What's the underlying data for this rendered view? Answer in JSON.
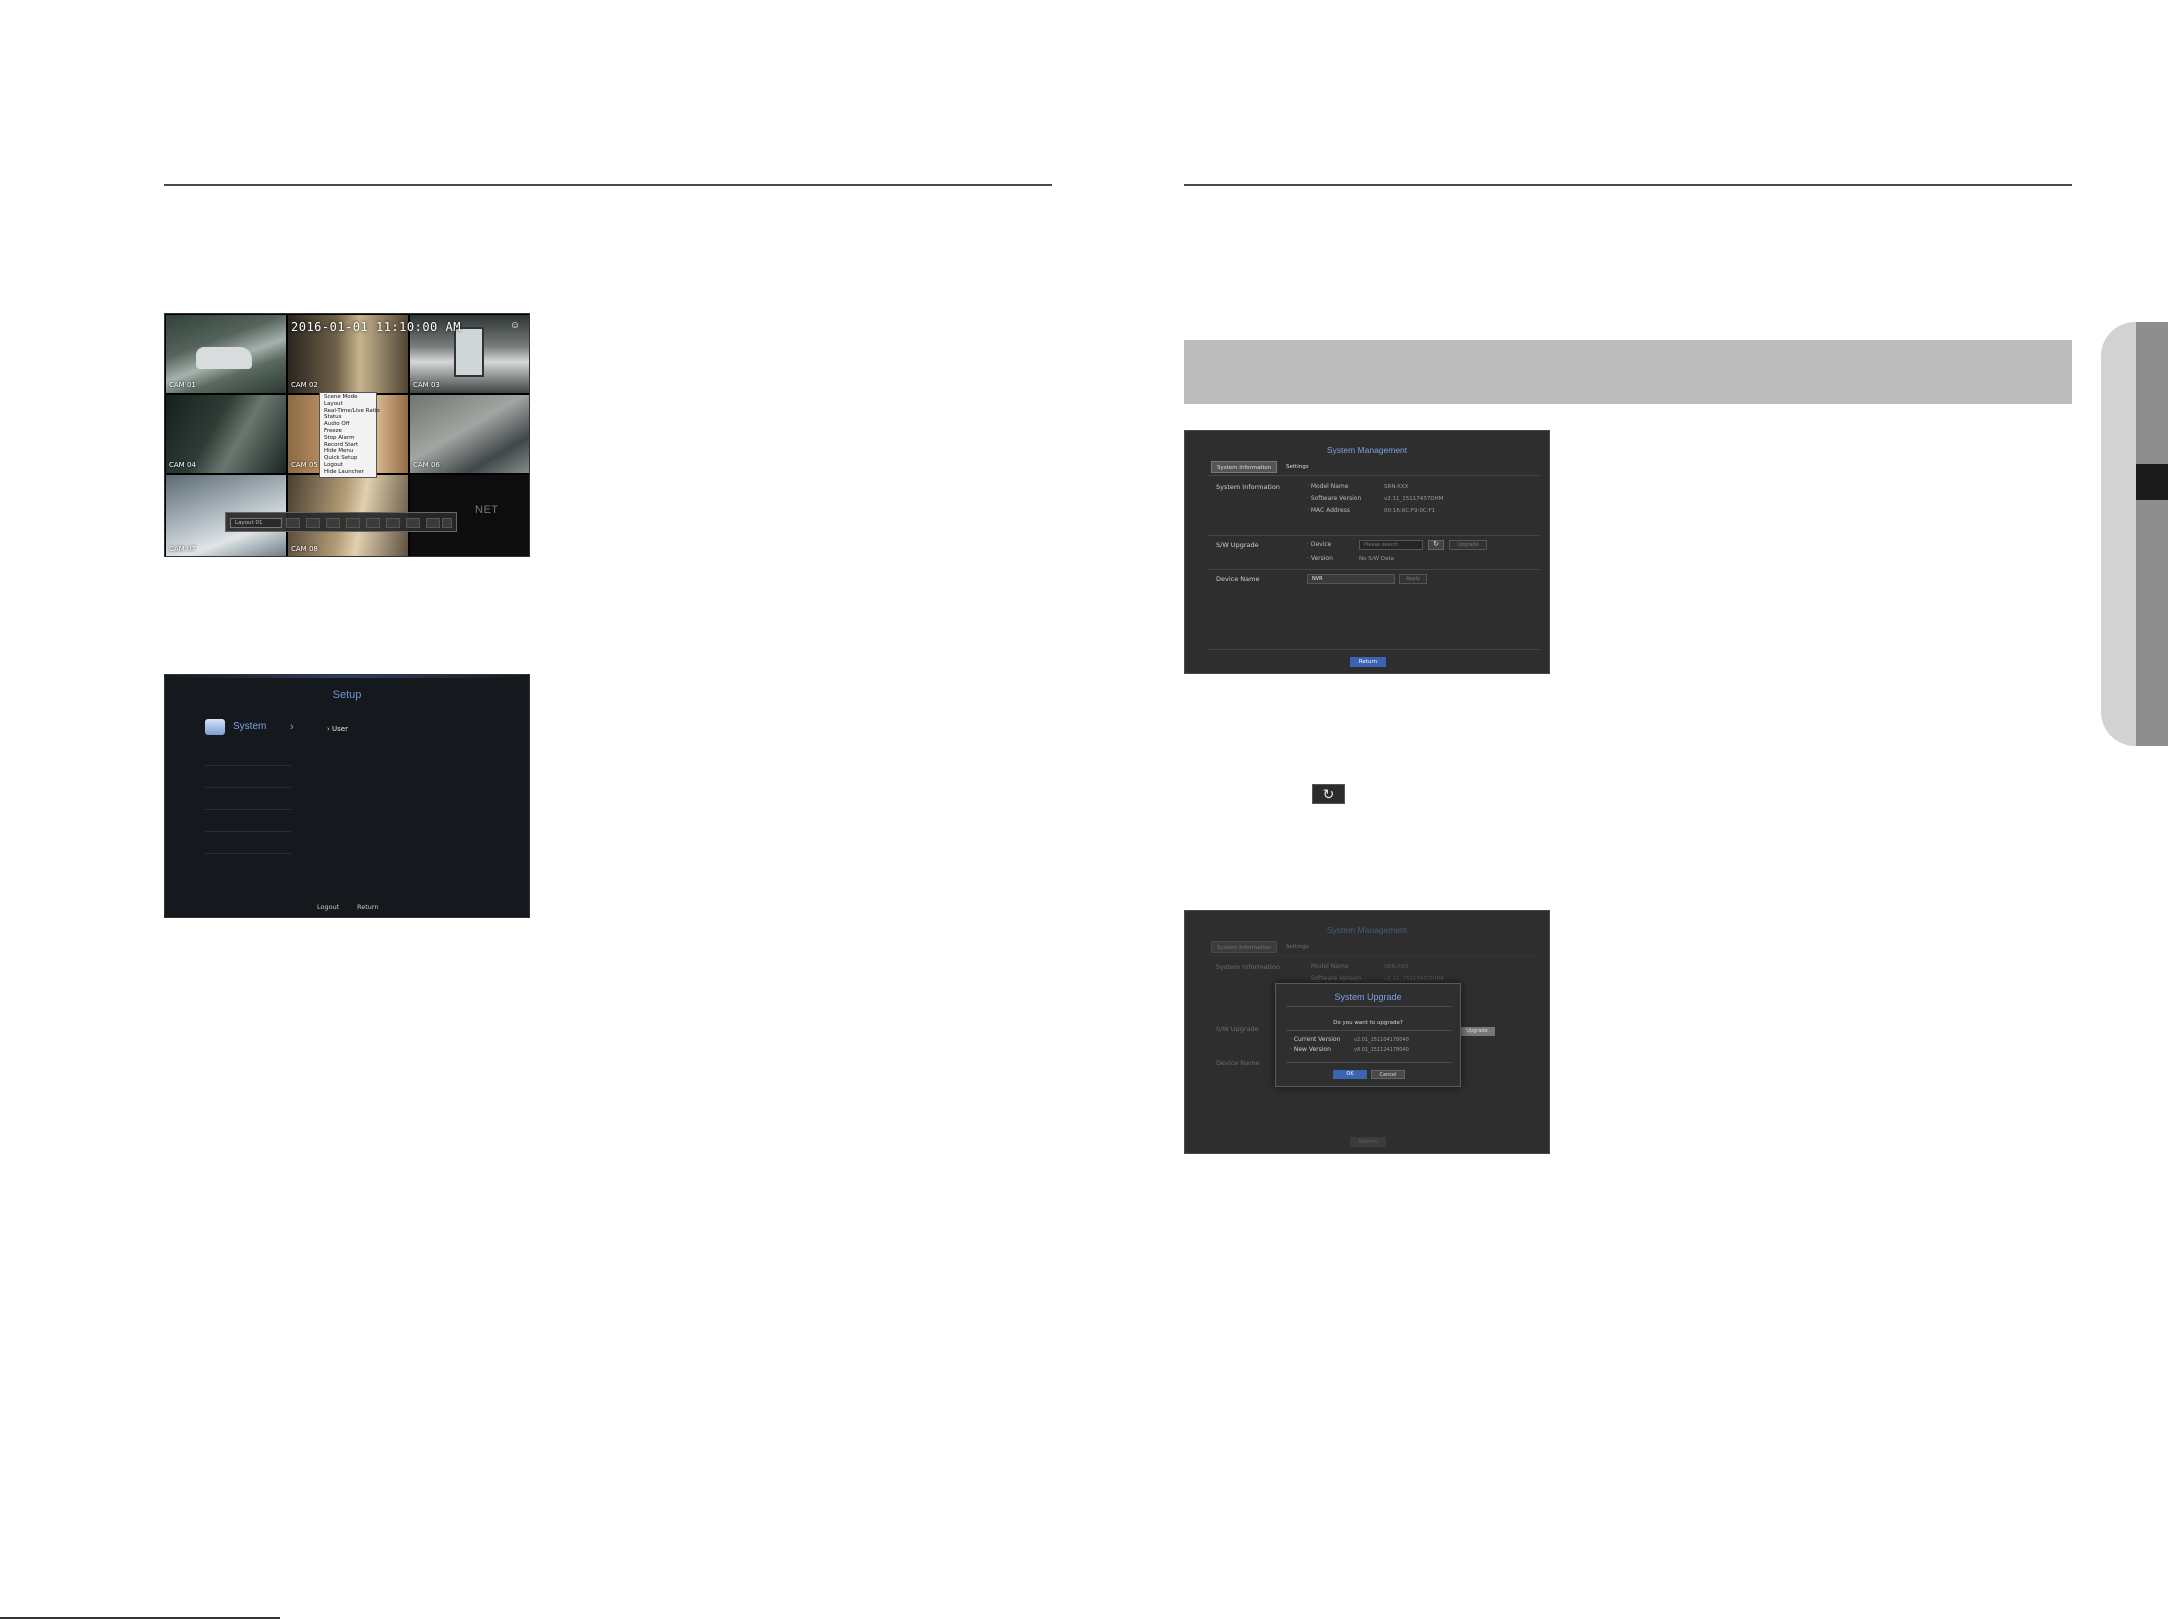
{
  "live_view": {
    "osd_time": "2016-01-01 11:10:00 AM",
    "watermark": "NET",
    "cameras": [
      "CAM 01",
      "CAM 02",
      "CAM 03",
      "CAM 04",
      "CAM 05",
      "CAM 06",
      "CAM 07",
      "CAM 08"
    ],
    "context_menu": [
      "Scene Mode",
      "Layout",
      "Real-Time/Live Ratio",
      "Status",
      "Audio Off",
      "Freeze",
      "Stop Alarm",
      "Record Start",
      "Hide Menu",
      "Quick Setup",
      "Logout",
      "Hide Launcher"
    ],
    "layout_select": "Layout 01"
  },
  "setup": {
    "title": "Setup",
    "menu_item": "System",
    "submenu_item": "User",
    "logout": "Logout",
    "return": "Return"
  },
  "sysmgmt1": {
    "title": "System Management",
    "tabs": [
      "System Information",
      "Settings"
    ],
    "system_info_label": "System Information",
    "model_name_key": "Model Name",
    "model_name_val": "SRN-XXX",
    "software_version_key": "Software Version",
    "software_version_val": "v2.11_15117437DHM",
    "mac_address_key": "MAC Address",
    "mac_address_val": "00:16:6C:F9:0C:F1",
    "sw_upgrade_label": "S/W Upgrade",
    "device_key": "Device",
    "device_placeholder": "Please search",
    "upgrade_btn": "Upgrade",
    "version_key": "Version",
    "version_val": "No S/W Data",
    "device_name_label": "Device Name",
    "device_name_val": "NVR",
    "apply_btn": "Apply",
    "return_btn": "Return"
  },
  "sysmgmt2": {
    "title": "System Management",
    "tabs": [
      "System Information",
      "Settings"
    ],
    "system_info_label": "System Information",
    "model_name_key": "Model Name",
    "model_name_val": "SRN-XXX",
    "software_version_key": "Software Version",
    "software_version_val": "v2.11_15117437DHM",
    "sw_upgrade_label": "S/W Upgrade",
    "device_name_label": "Device Name",
    "upgrade_btn": "Upgrade",
    "return_btn": "Return",
    "dialog": {
      "title": "System Upgrade",
      "question": "Do you want to upgrade?",
      "current_version_key": "Current Version",
      "current_version_val": "v2.01_151104178040",
      "new_version_key": "New Version",
      "new_version_val": "v8.01_151124178040",
      "ok": "OK",
      "cancel": "Cancel"
    }
  },
  "icons": {
    "refresh": "refresh-icon",
    "user": "user-icon"
  },
  "colors": {
    "accent": "#3b64b3",
    "title_blue": "#7ba1e0",
    "section_bar": "#bcbcbc"
  }
}
